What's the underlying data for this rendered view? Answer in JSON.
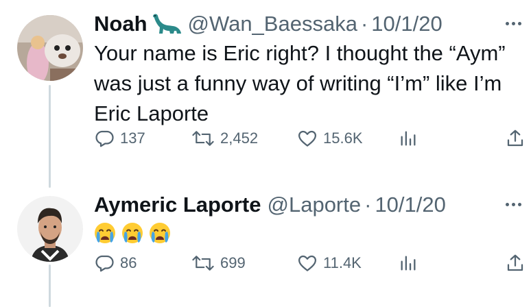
{
  "tweets": [
    {
      "name": "Noah",
      "name_emoji": "sauropod",
      "handle": "@Wan_Baessaka",
      "separator": "·",
      "date": "10/1/20",
      "text_lines": [
        "Your name is Eric right? I thought the “Aym”",
        "was just a funny way of writing “I’m” like I’m",
        "Eric Laporte"
      ],
      "replies": "137",
      "retweets": "2,452",
      "likes": "15.6K"
    },
    {
      "name": "Aymeric Laporte",
      "handle": "@Laporte",
      "separator": "·",
      "date": "10/1/20",
      "emojis": [
        "crying-face",
        "crying-face",
        "crying-face"
      ],
      "replies": "86",
      "retweets": "699",
      "likes": "11.4K"
    }
  ],
  "icons": {
    "reply": "speech-bubble-icon",
    "retweet": "retweet-arrows-icon",
    "like": "heart-icon",
    "views": "bar-chart-icon",
    "share": "share-upload-icon",
    "more": "more-dots-icon"
  },
  "colors": {
    "text": "#0f1419",
    "secondary": "#536471",
    "thread_line": "#cfd9de"
  }
}
